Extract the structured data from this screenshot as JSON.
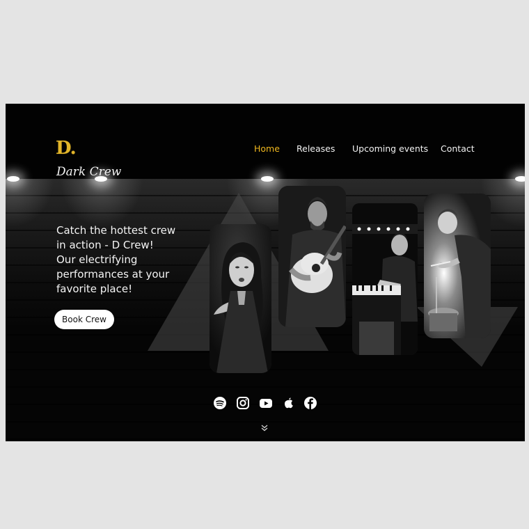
{
  "brand": {
    "mark": "D.",
    "name": "Dark Crew"
  },
  "nav": {
    "items": [
      {
        "label": "Home",
        "active": true
      },
      {
        "label": "Releases",
        "active": false
      },
      {
        "label": "Upcoming events",
        "active": false
      },
      {
        "label": "Contact",
        "active": false
      }
    ]
  },
  "hero": {
    "headline": "Catch the hottest crew\nin action - D Crew!\n Our electrifying\nperformances at your\nfavorite place!",
    "cta_label": "Book Crew"
  },
  "gallery": [
    {
      "icon": "singer-photo"
    },
    {
      "icon": "guitarist-photo"
    },
    {
      "icon": "pianist-photo"
    },
    {
      "icon": "drummer-photo"
    }
  ],
  "socials": [
    {
      "icon": "spotify-icon"
    },
    {
      "icon": "instagram-icon"
    },
    {
      "icon": "youtube-icon"
    },
    {
      "icon": "apple-icon"
    },
    {
      "icon": "facebook-icon"
    }
  ],
  "scroll": {
    "icon": "chevron-down-icon"
  },
  "colors": {
    "accent": "#f0b81e",
    "background": "#050505",
    "page": "#e4e4e4"
  }
}
